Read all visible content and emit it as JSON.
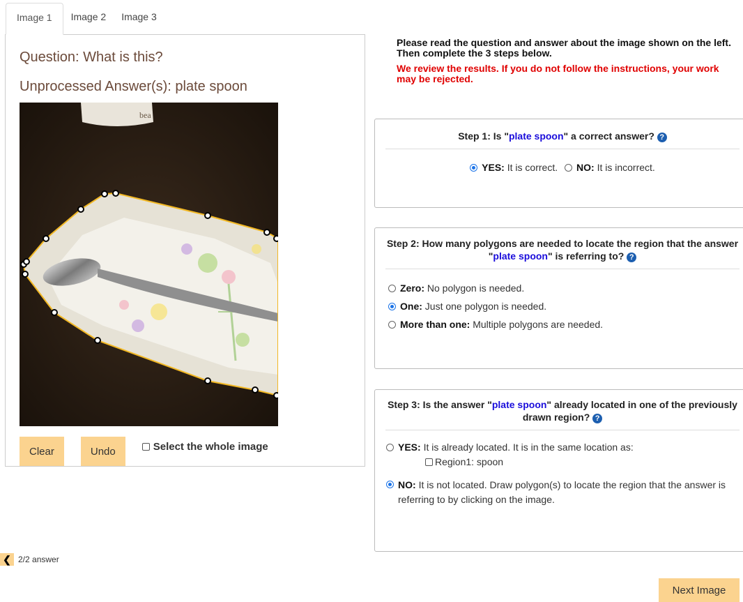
{
  "tabs": [
    "Image 1",
    "Image 2",
    "Image 3"
  ],
  "left": {
    "question": "Question: What is this?",
    "answer": "Unprocessed Answer(s): plate spoon",
    "photo_text": "bea",
    "clear_label": "Clear",
    "undo_label": "Undo",
    "whole_label": "Select the whole image"
  },
  "instructions": {
    "line1": "Please read the question and answer about the image shown on the left. Then complete the 3 steps below.",
    "warning": "We review the results. If you do not follow the instructions, your work may be rejected."
  },
  "step1": {
    "prefix": "Step 1: Is \"",
    "answer": "plate spoon",
    "suffix": "\" a correct answer?",
    "yes_label": "YES:",
    "yes_text": "It is correct.",
    "no_label": "NO:",
    "no_text": "It is incorrect."
  },
  "step2": {
    "prefix": "Step 2: How many polygons are needed to locate the region that the answer \"",
    "answer": "plate spoon",
    "suffix": "\" is referring to?",
    "options": [
      {
        "label": "Zero:",
        "text": "No polygon is needed."
      },
      {
        "label": "One:",
        "text": "Just one polygon is needed."
      },
      {
        "label": "More than one:",
        "text": "Multiple polygons are needed."
      }
    ]
  },
  "step3": {
    "prefix": "Step 3: Is the answer \"",
    "answer": "plate spoon",
    "suffix": "\" already located in one of the previously drawn region?",
    "yes_label": "YES:",
    "yes_text": "It is already located. It is in the same location as:",
    "region_label": "Region1: spoon",
    "no_label": "NO:",
    "no_text": "It is not located. Draw polygon(s) to locate the region that the answer is referring to by clicking on the image."
  },
  "nav": {
    "counter": "2/2 answer"
  },
  "next_label": "Next Image",
  "colors": {
    "button": "#fbd38f",
    "accent_blue": "#1a0ddb",
    "warning_red": "#e00000",
    "polygon": "#f2b824"
  }
}
